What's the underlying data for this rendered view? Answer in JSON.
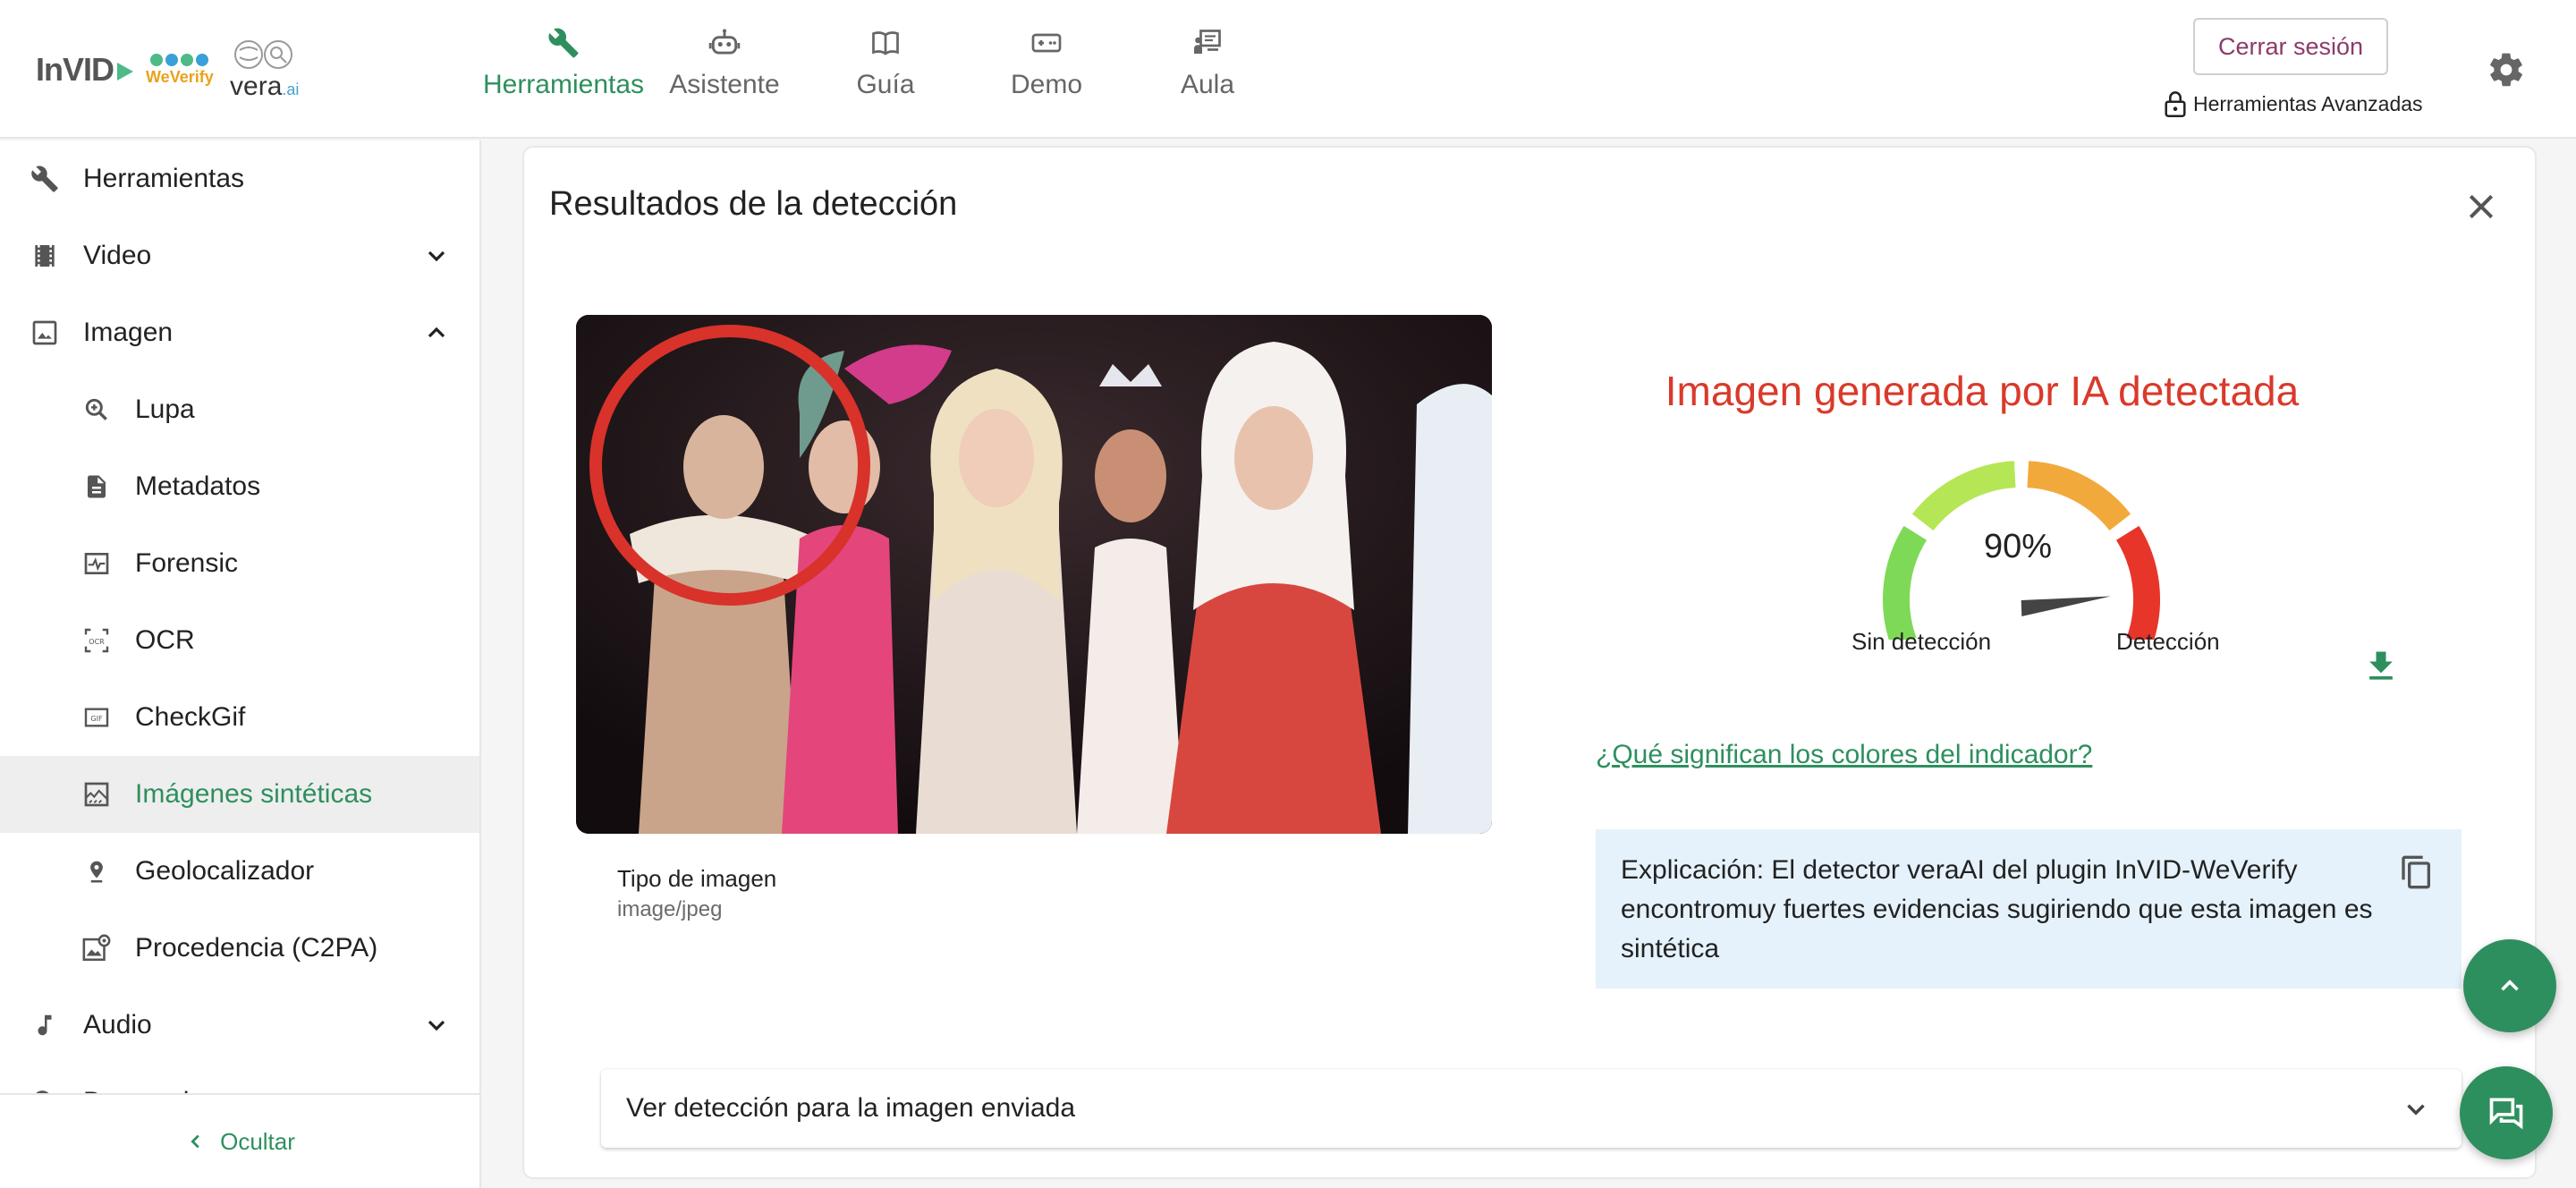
{
  "brand": {
    "invid": "InVID",
    "weverify": "WeVerify",
    "vera": "vera",
    "vera_suffix": ".ai"
  },
  "nav": [
    {
      "label": "Herramientas",
      "icon": "wrench-icon",
      "active": true
    },
    {
      "label": "Asistente",
      "icon": "robot-icon",
      "active": false
    },
    {
      "label": "Guía",
      "icon": "book-icon",
      "active": false
    },
    {
      "label": "Demo",
      "icon": "gamepad-icon",
      "active": false
    },
    {
      "label": "Aula",
      "icon": "classroom-icon",
      "active": false
    }
  ],
  "header": {
    "logout": "Cerrar sesión",
    "advanced_tools": "Herramientas Avanzadas"
  },
  "sidebar": {
    "items": [
      {
        "label": "Herramientas",
        "icon": "wrench-icon"
      },
      {
        "label": "Video",
        "icon": "film-icon",
        "expand": "collapsed"
      },
      {
        "label": "Imagen",
        "icon": "image-icon",
        "expand": "expanded"
      },
      {
        "label": "Lupa",
        "icon": "magnifier-icon"
      },
      {
        "label": "Metadatos",
        "icon": "document-icon"
      },
      {
        "label": "Forensic",
        "icon": "forensic-icon"
      },
      {
        "label": "OCR",
        "icon": "ocr-icon"
      },
      {
        "label": "CheckGif",
        "icon": "gif-icon"
      },
      {
        "label": "Imágenes sintéticas",
        "icon": "synthetic-icon",
        "selected": true
      },
      {
        "label": "Geolocalizador",
        "icon": "location-pin-icon"
      },
      {
        "label": "Procedencia (C2PA)",
        "icon": "provenance-icon"
      },
      {
        "label": "Audio",
        "icon": "music-note-icon",
        "expand": "collapsed"
      },
      {
        "label": "Busqueda",
        "icon": "search-icon",
        "expand": "collapsed"
      }
    ],
    "hide_label": "Ocultar"
  },
  "card": {
    "title": "Resultados de la detección",
    "image_type_label": "Tipo de imagen",
    "image_type_value": "image/jpeg",
    "result_title": "Imagen generada por IA detectada",
    "gauge": {
      "value": 90,
      "value_text": "90%",
      "left_label": "Sin detección",
      "right_label": "Detección",
      "segment_colors": [
        "#7ed957",
        "#b5e655",
        "#f2a93b",
        "#e8352a"
      ],
      "needle_color": "#444444"
    },
    "colors_link": "¿Qué significan los colores del indicador?",
    "explanation": "Explicación: El detector veraAI del plugin InVID-WeVerify encontromuy fuertes evidencias sugiriendo que esta imagen es sintética",
    "accordion_label": "Ver detección para la imagen enviada"
  },
  "colors": {
    "accent": "#2e8f5e",
    "alert": "#d93a2b",
    "info_bg": "#e5f2fb",
    "logout_text": "#8c3a6a"
  }
}
